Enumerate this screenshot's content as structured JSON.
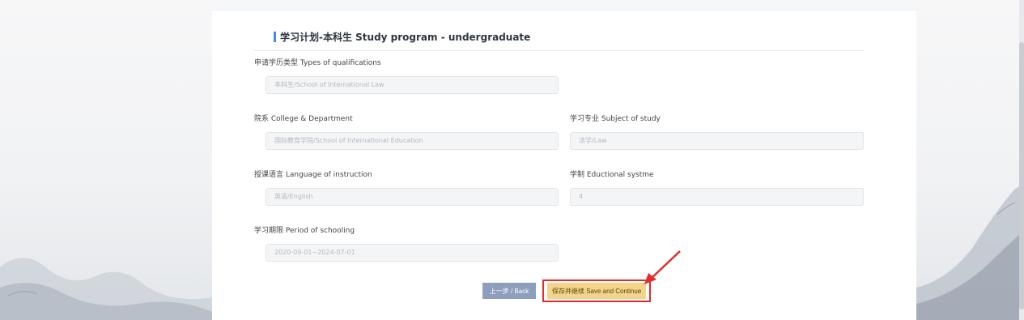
{
  "section": {
    "title": "学习计划-本科生 Study program - undergraduate"
  },
  "fields": [
    {
      "label": "申请学历类型 Types of qualifications",
      "value": "本科生/School of International Law"
    },
    {
      "label": "院系 College & Department",
      "value": "国际教育学院/School of International Education"
    },
    {
      "label": "学习专业 Subject of study",
      "value": "法学/Law"
    },
    {
      "label": "授课语言 Language of instruction",
      "value": "英语/English"
    },
    {
      "label": "学制 Eductional systme",
      "value": "4"
    },
    {
      "label": "学习期限 Period of schooling",
      "value": "2020-09-01~2024-07-01"
    }
  ],
  "buttons": {
    "back": "上一步 / Back",
    "save": "保存并继续 Save and Continue"
  },
  "annotation": {
    "color": "#e52a2a"
  },
  "colors": {
    "accent": "#3f8be8",
    "back_button": "#8d9fbd",
    "save_button": "#f3d48d"
  }
}
